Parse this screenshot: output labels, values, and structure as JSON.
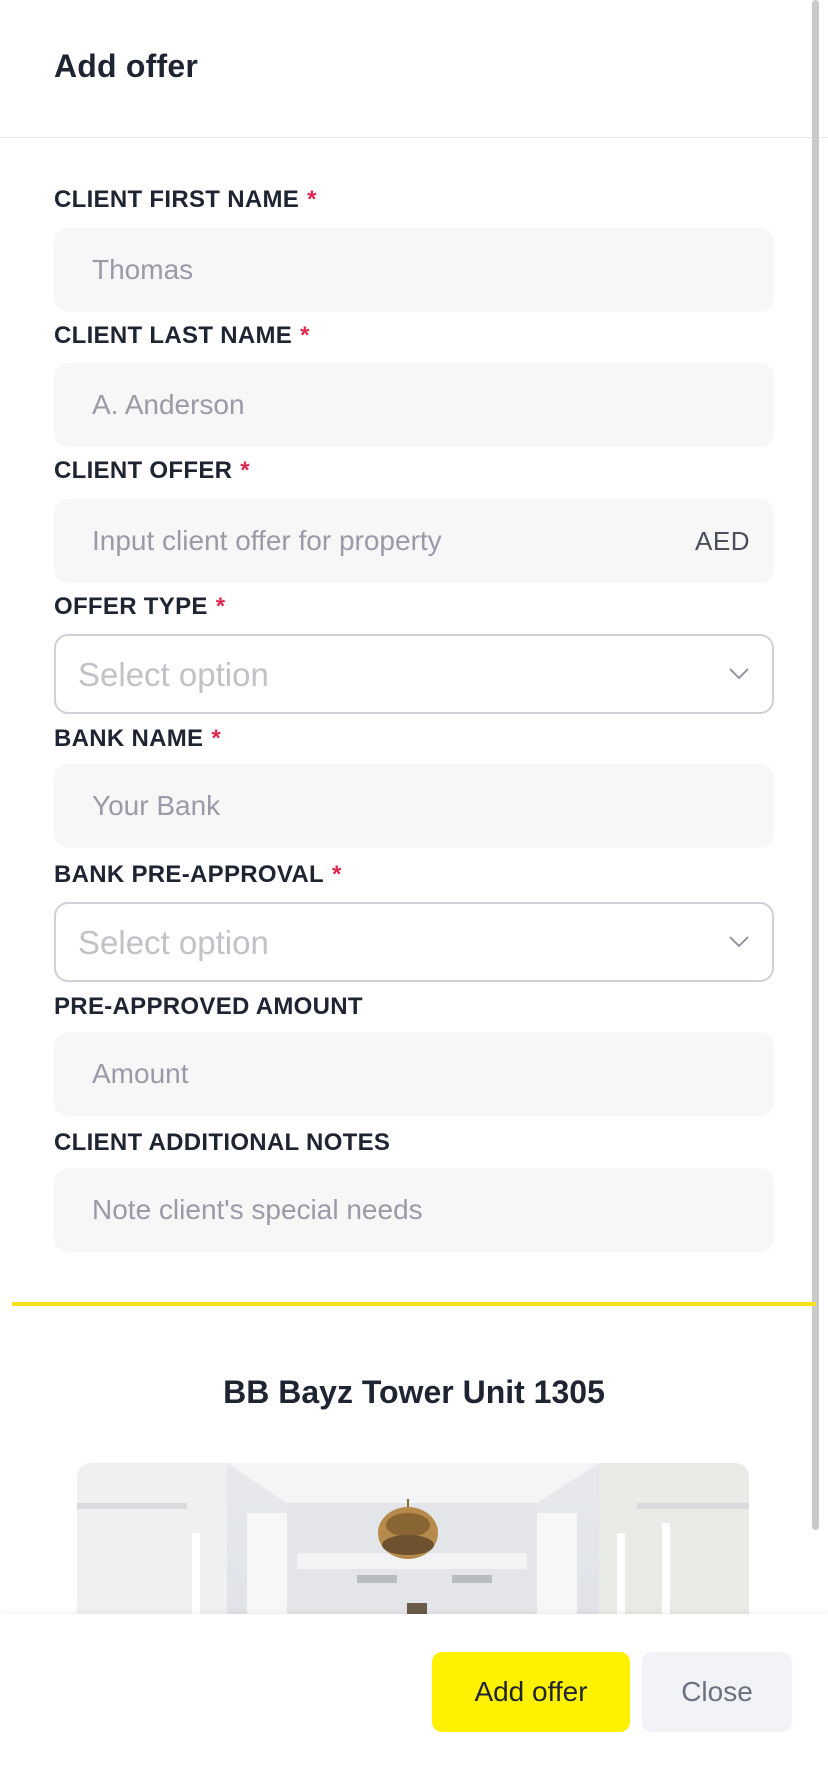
{
  "header": {
    "title": "Add offer"
  },
  "form": {
    "required_mark": "*",
    "first_name": {
      "label": "CLIENT FIRST NAME",
      "placeholder": "Thomas"
    },
    "last_name": {
      "label": "CLIENT LAST NAME",
      "placeholder": "A. Anderson"
    },
    "offer": {
      "label": "CLIENT OFFER",
      "placeholder": "Input client offer for property",
      "currency": "AED"
    },
    "offer_type": {
      "label": "OFFER TYPE",
      "selected": "Select option"
    },
    "bank_name": {
      "label": "BANK NAME",
      "placeholder": "Your Bank"
    },
    "pre_approval": {
      "label": "BANK PRE-APPROVAL",
      "selected": "Select option"
    },
    "pre_approved_amount": {
      "label": "PRE-APPROVED AMOUNT",
      "placeholder": "Amount"
    },
    "notes": {
      "label": "CLIENT ADDITIONAL NOTES",
      "placeholder": "Note client's special needs"
    }
  },
  "property": {
    "title": "BB Bayz Tower Unit 1305"
  },
  "footer": {
    "add_label": "Add offer",
    "close_label": "Close"
  },
  "colors": {
    "accent": "#fff200",
    "divider": "#f6e31a",
    "required": "#e0284f"
  },
  "icons": {
    "dropdown": "chevron-down-icon"
  }
}
